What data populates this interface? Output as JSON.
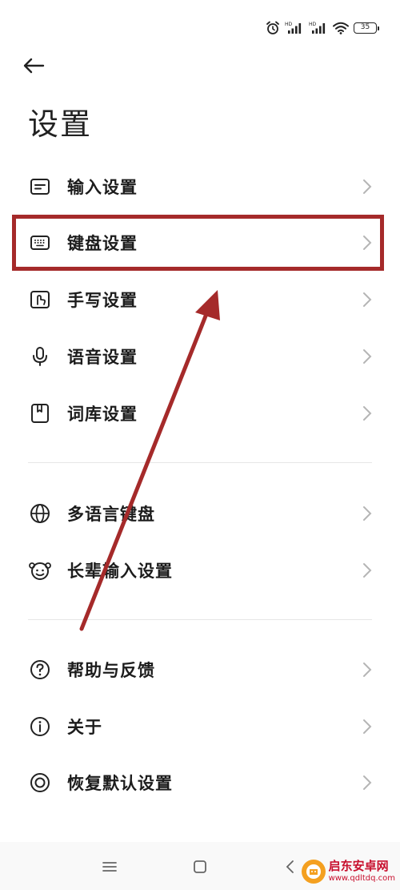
{
  "status_bar": {
    "icons": [
      "alarm-icon",
      "hd-signal-icon",
      "hd-signal-icon",
      "wifi-icon"
    ],
    "battery": "35"
  },
  "header": {
    "back_icon": "arrow-left-icon",
    "title": "设置"
  },
  "groups": [
    {
      "items": [
        {
          "label": "输入设置",
          "icon": "input-settings-icon"
        },
        {
          "label": "键盘设置",
          "icon": "keyboard-icon"
        },
        {
          "label": "手写设置",
          "icon": "handwriting-icon"
        },
        {
          "label": "语音设置",
          "icon": "microphone-icon"
        },
        {
          "label": "词库设置",
          "icon": "dictionary-icon"
        }
      ]
    },
    {
      "items": [
        {
          "label": "多语言键盘",
          "icon": "globe-icon"
        },
        {
          "label": "长辈输入设置",
          "icon": "elder-face-icon"
        }
      ]
    },
    {
      "items": [
        {
          "label": "帮助与反馈",
          "icon": "help-icon"
        },
        {
          "label": "关于",
          "icon": "info-icon"
        },
        {
          "label": "恢复默认设置",
          "icon": "restore-icon"
        }
      ]
    }
  ],
  "annotation": {
    "highlighted_item": "键盘设置",
    "color": "#a52a2a"
  },
  "nav_bar": {
    "buttons": [
      "menu-icon",
      "home-icon",
      "back-icon"
    ]
  },
  "watermark": {
    "title": "启东安卓网",
    "url": "www.qdltdq.com"
  }
}
